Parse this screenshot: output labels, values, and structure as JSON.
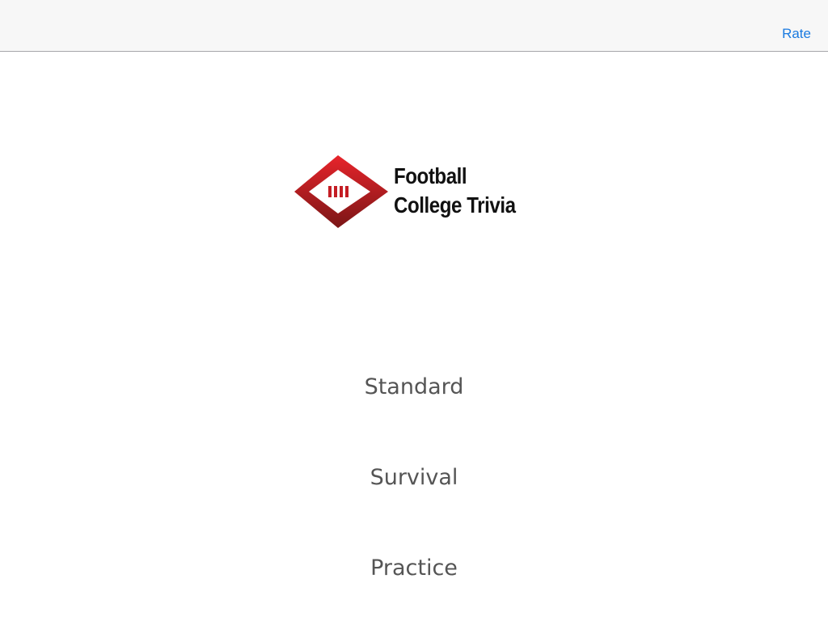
{
  "navbar": {
    "rate_label": "Rate"
  },
  "logo": {
    "line1": "Football",
    "line2": "College Trivia"
  },
  "menu": {
    "standard": "Standard",
    "survival": "Survival",
    "practice": "Practice"
  },
  "colors": {
    "accent": "#1a7ae0",
    "logo_red": "#d61f26",
    "logo_dark_red": "#8b1a1a",
    "menu_text": "#555555"
  }
}
